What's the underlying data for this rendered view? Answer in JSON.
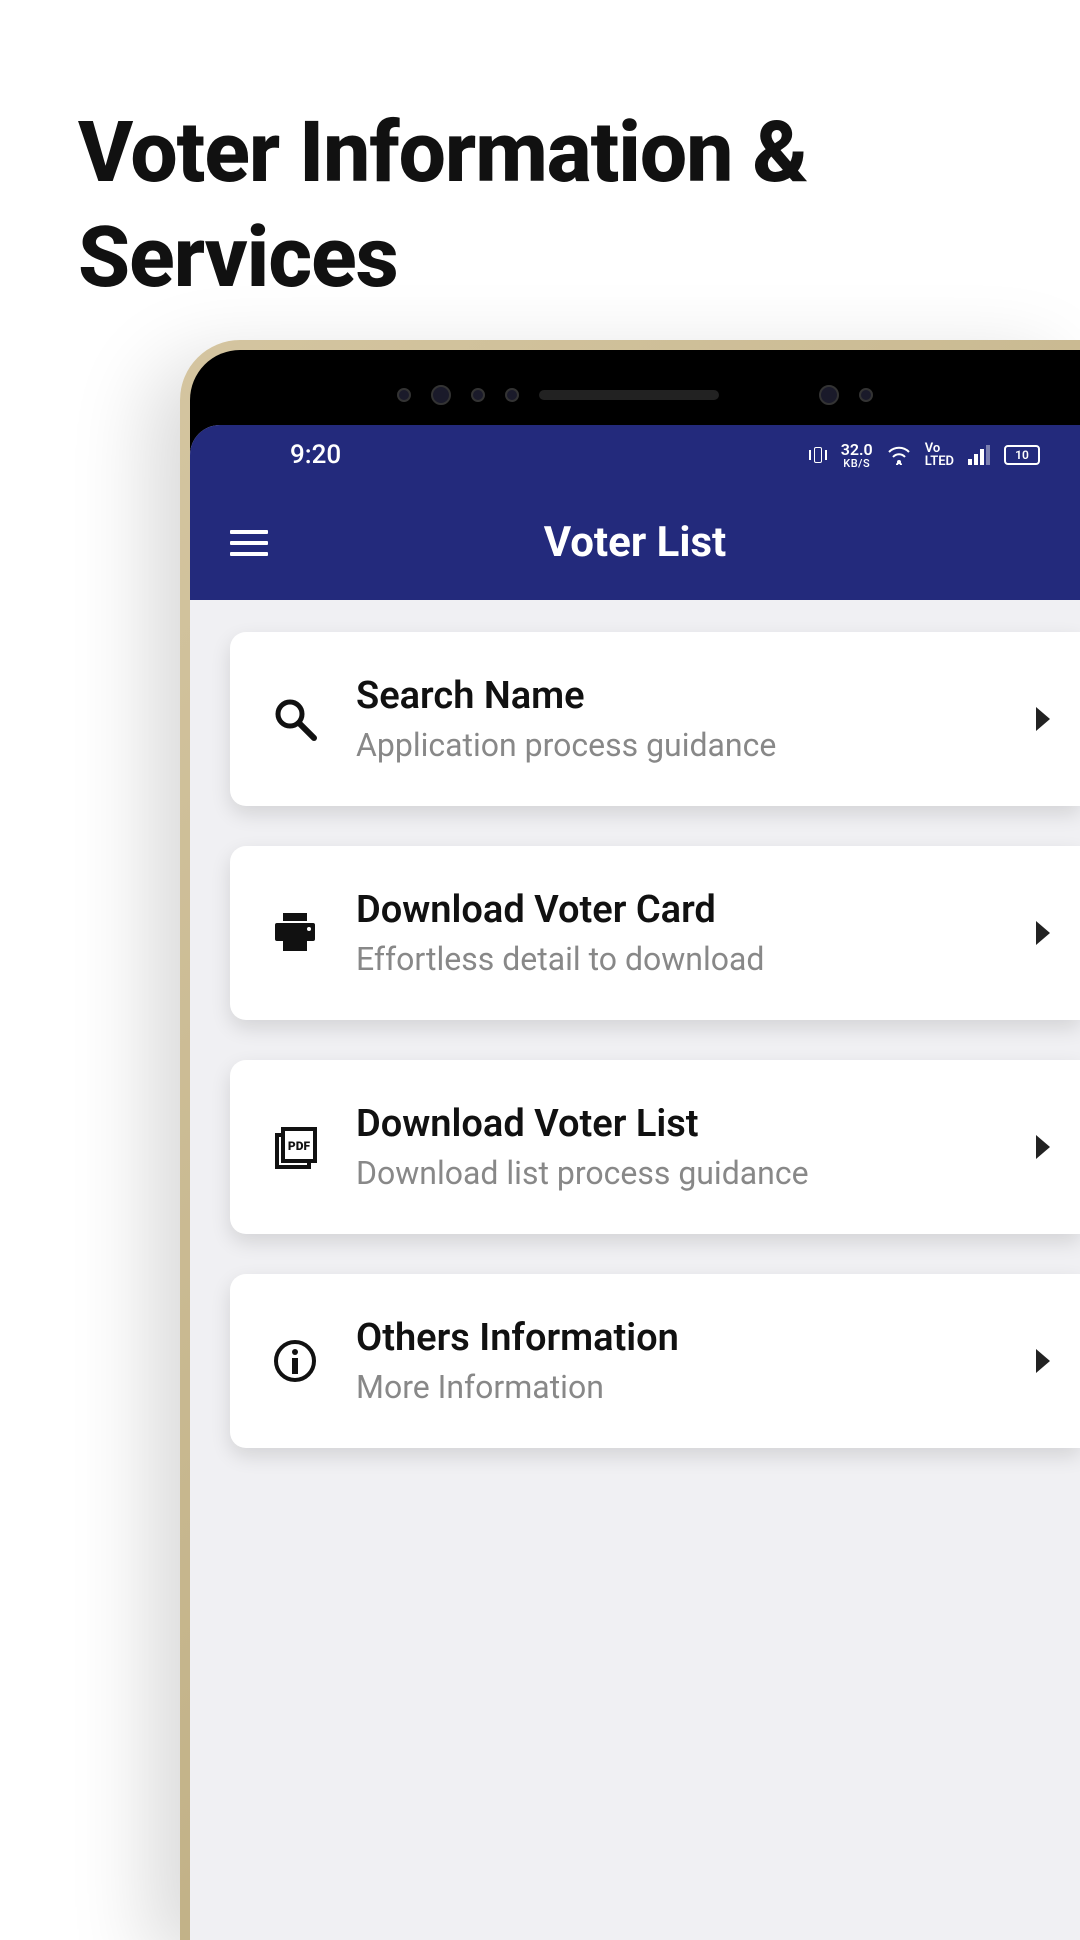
{
  "page": {
    "title": "Voter Information & Services"
  },
  "statusBar": {
    "time": "9:20",
    "dataSpeed": "32.0",
    "dataUnit": "KB/S",
    "volte": "Vo\nLTED",
    "battery": "10"
  },
  "header": {
    "title": "Voter List"
  },
  "cards": [
    {
      "title": "Search Name",
      "subtitle": "Application process guidance",
      "icon": "search"
    },
    {
      "title": "Download Voter Card",
      "subtitle": "Effortless detail to download",
      "icon": "print"
    },
    {
      "title": "Download Voter List",
      "subtitle": "Download list process guidance",
      "icon": "pdf"
    },
    {
      "title": "Others Information",
      "subtitle": "More Information",
      "icon": "info"
    }
  ]
}
